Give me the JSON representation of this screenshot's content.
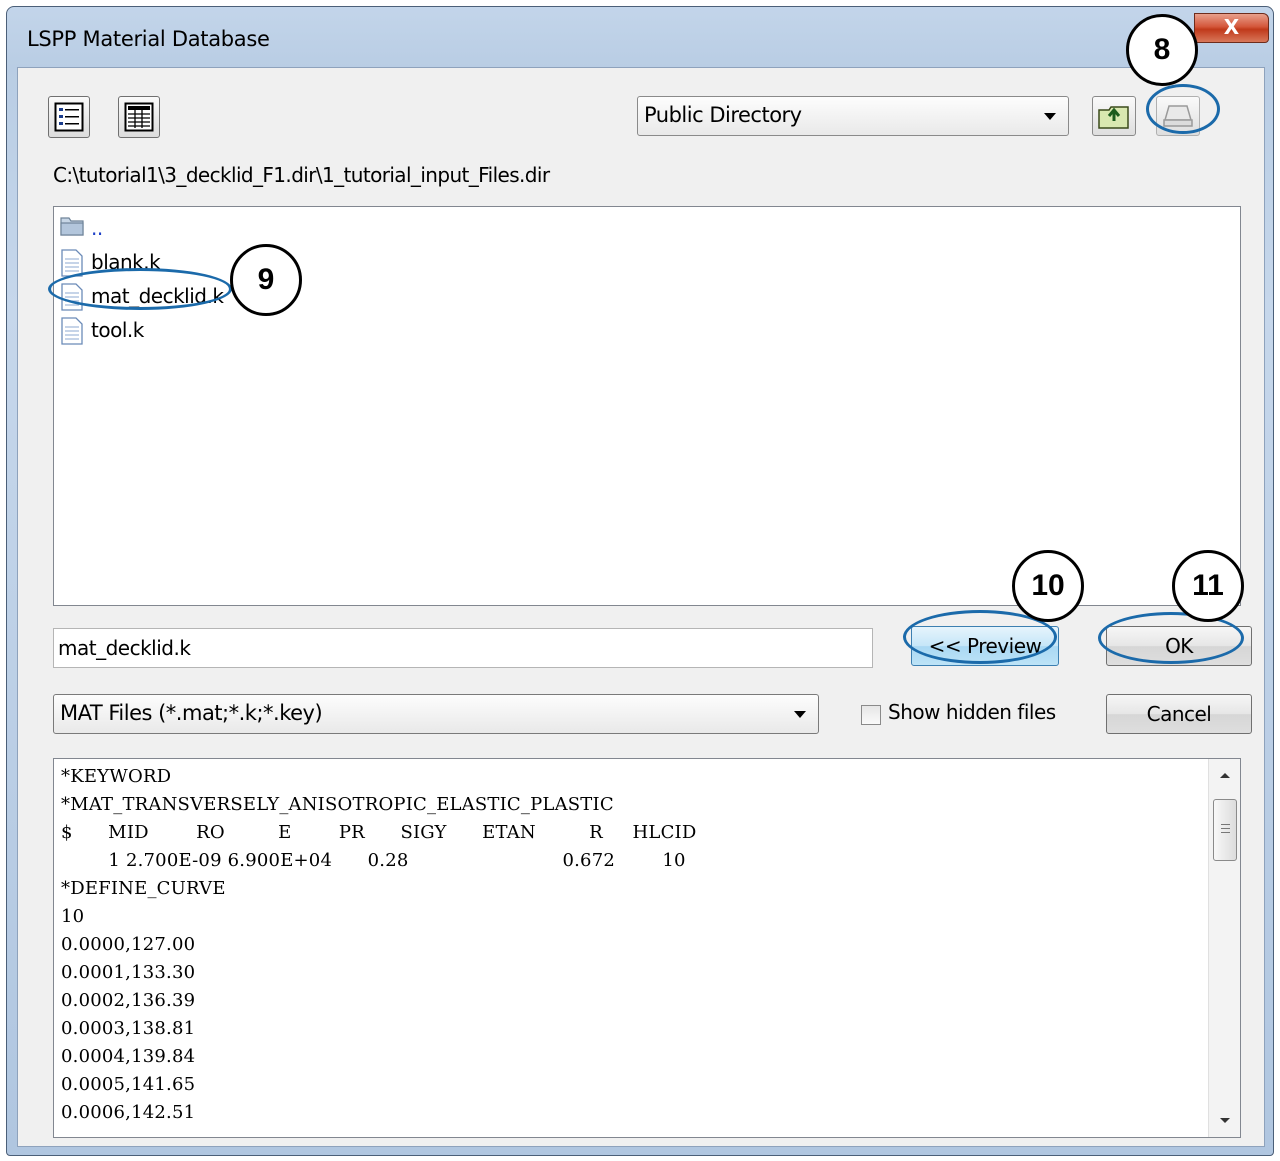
{
  "window": {
    "title": "LSPP Material Database",
    "close_label": "X"
  },
  "toolbar": {
    "directory_select": "Public Directory"
  },
  "path": "C:\\tutorial1\\3_decklid_F1.dir\\1_tutorial_input_Files.dir",
  "files": [
    {
      "name": "..",
      "type": "folder"
    },
    {
      "name": "blank.k",
      "type": "file"
    },
    {
      "name": "mat_decklid.k",
      "type": "file"
    },
    {
      "name": "tool.k",
      "type": "file"
    }
  ],
  "filename_value": "mat_decklid.k",
  "filetype_select": "MAT Files (*.mat;*.k;*.key)",
  "show_hidden_label": "Show hidden files",
  "buttons": {
    "preview": "<< Preview",
    "ok": "OK",
    "cancel": "Cancel"
  },
  "preview_lines": [
    "*KEYWORD",
    "*MAT_TRANSVERSELY_ANISOTROPIC_ELASTIC_PLASTIC",
    "$      MID        RO         E        PR      SIGY      ETAN         R     HLCID",
    "        1 2.700E-09 6.900E+04      0.28                          0.672        10",
    "*DEFINE_CURVE",
    "10",
    "0.0000,127.00",
    "0.0001,133.30",
    "0.0002,136.39",
    "0.0003,138.81",
    "0.0004,139.84",
    "0.0005,141.65",
    "0.0006,142.51"
  ],
  "callouts": {
    "c8": "8",
    "c9": "9",
    "c10": "10",
    "c11": "11"
  },
  "colors": {
    "callout_ring": "#1b6aaa",
    "folder_parent_text": "#1c3fc7"
  }
}
